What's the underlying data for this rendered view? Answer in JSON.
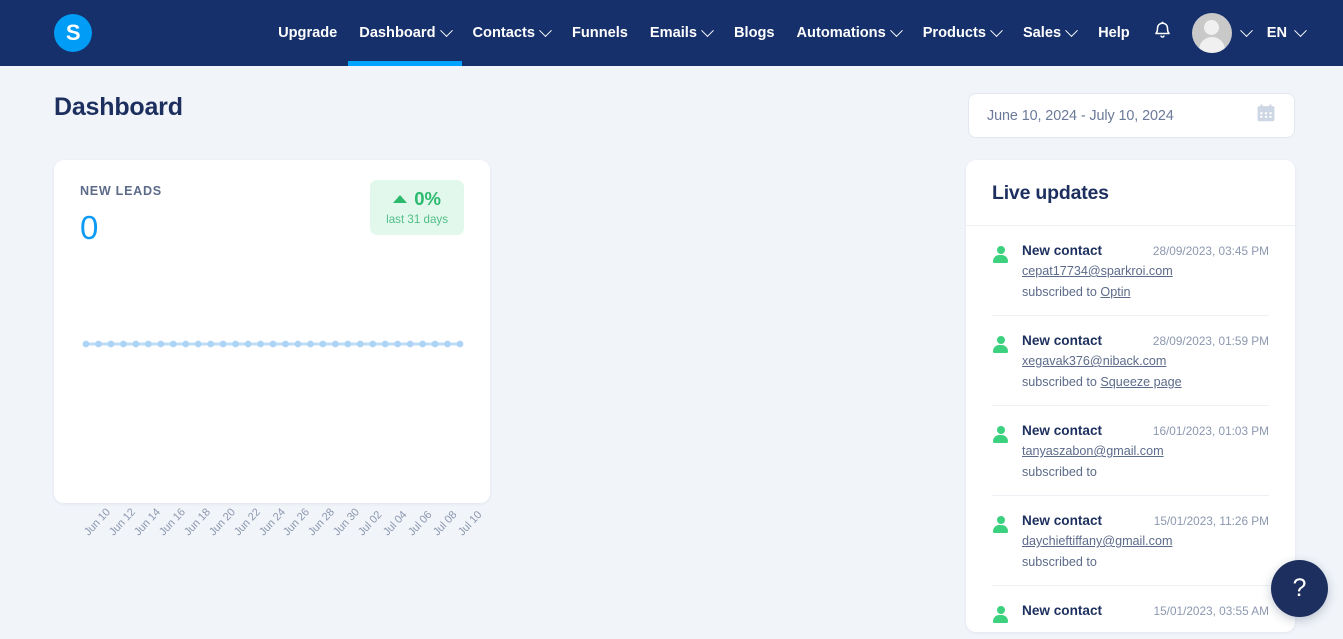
{
  "nav": {
    "logo_text": "S",
    "items": [
      {
        "label": "Upgrade",
        "has_caret": false,
        "active": false
      },
      {
        "label": "Dashboard",
        "has_caret": true,
        "active": true
      },
      {
        "label": "Contacts",
        "has_caret": true,
        "active": false
      },
      {
        "label": "Funnels",
        "has_caret": false,
        "active": false
      },
      {
        "label": "Emails",
        "has_caret": true,
        "active": false
      },
      {
        "label": "Blogs",
        "has_caret": false,
        "active": false
      },
      {
        "label": "Automations",
        "has_caret": true,
        "active": false
      },
      {
        "label": "Products",
        "has_caret": true,
        "active": false
      },
      {
        "label": "Sales",
        "has_caret": true,
        "active": false
      },
      {
        "label": "Help",
        "has_caret": false,
        "active": false
      }
    ],
    "notification_icon": "bell-icon",
    "avatar_icon": "user-avatar",
    "language": "EN",
    "accent_active": "#00A3FF",
    "bar_color": "#16306B"
  },
  "page": {
    "title": "Dashboard",
    "background": "#F1F4F9"
  },
  "date_picker": {
    "value": "June 10, 2024 - July 10, 2024",
    "icon": "calendar-icon"
  },
  "leads_card": {
    "label": "NEW LEADS",
    "value": "0",
    "value_color": "#0D9BF5",
    "delta_percent": "0%",
    "delta_period": "last 31 days",
    "delta_direction": "up",
    "delta_color": "#2BBA6E",
    "delta_bg": "#E3F8EC"
  },
  "chart_data": {
    "type": "line",
    "title": "NEW LEADS",
    "xlabel": "",
    "ylabel": "",
    "ylim": [
      0,
      1
    ],
    "grid": false,
    "legend": "none",
    "line_color": "#BDDDF7",
    "marker_color": "#AED4F5",
    "x": [
      "Jun 10",
      "Jun 11",
      "Jun 12",
      "Jun 13",
      "Jun 14",
      "Jun 15",
      "Jun 16",
      "Jun 17",
      "Jun 18",
      "Jun 19",
      "Jun 20",
      "Jun 21",
      "Jun 22",
      "Jun 23",
      "Jun 24",
      "Jun 25",
      "Jun 26",
      "Jun 27",
      "Jun 28",
      "Jun 29",
      "Jun 30",
      "Jul 01",
      "Jul 02",
      "Jul 03",
      "Jul 04",
      "Jul 05",
      "Jul 06",
      "Jul 07",
      "Jul 08",
      "Jul 09",
      "Jul 10"
    ],
    "values": [
      0,
      0,
      0,
      0,
      0,
      0,
      0,
      0,
      0,
      0,
      0,
      0,
      0,
      0,
      0,
      0,
      0,
      0,
      0,
      0,
      0,
      0,
      0,
      0,
      0,
      0,
      0,
      0,
      0,
      0,
      0
    ],
    "tick_labels": [
      "Jun 10",
      "Jun 12",
      "Jun 14",
      "Jun 16",
      "Jun 18",
      "Jun 20",
      "Jun 22",
      "Jun 24",
      "Jun 26",
      "Jun 28",
      "Jun 30",
      "Jul 02",
      "Jul 04",
      "Jul 06",
      "Jul 08",
      "Jul 10"
    ]
  },
  "live_updates": {
    "title": "Live updates",
    "items": [
      {
        "kind": "New contact",
        "time": "28/09/2023, 03:45 PM",
        "email": "cepat17734@sparkroi.com",
        "subscribed_prefix": "subscribed to",
        "subscribed_to": "Optin"
      },
      {
        "kind": "New contact",
        "time": "28/09/2023, 01:59 PM",
        "email": "xegavak376@niback.com",
        "subscribed_prefix": "subscribed to",
        "subscribed_to": "Squeeze page"
      },
      {
        "kind": "New contact",
        "time": "16/01/2023, 01:03 PM",
        "email": "tanyaszabon@gmail.com",
        "subscribed_prefix": "subscribed to",
        "subscribed_to": ""
      },
      {
        "kind": "New contact",
        "time": "15/01/2023, 11:26 PM",
        "email": "daychieftiffany@gmail.com",
        "subscribed_prefix": "subscribed to",
        "subscribed_to": ""
      },
      {
        "kind": "New contact",
        "time": "15/01/2023, 03:55 AM",
        "email": "",
        "subscribed_prefix": "",
        "subscribed_to": ""
      }
    ]
  },
  "help_fab": {
    "label": "?",
    "color": "#1C2F5E"
  }
}
